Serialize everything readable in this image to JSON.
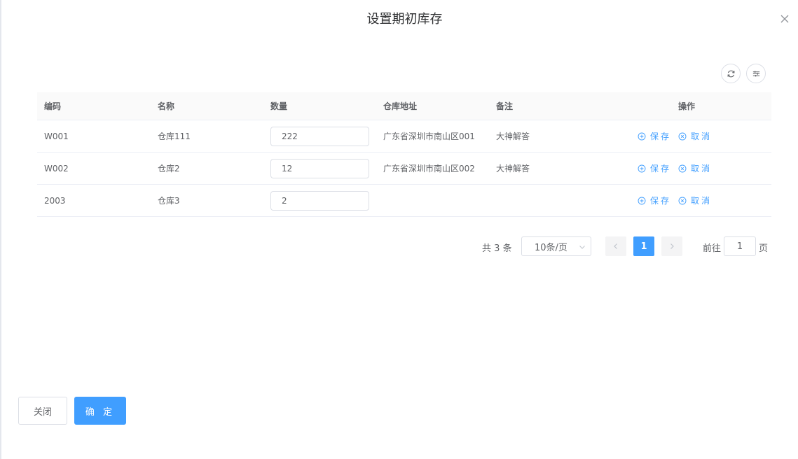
{
  "dialog": {
    "title": "设置期初库存"
  },
  "toolbar": {
    "refresh_icon": "refresh-icon",
    "settings_icon": "column-settings-icon"
  },
  "table": {
    "columns": [
      "编码",
      "名称",
      "数量",
      "仓库地址",
      "备注",
      "操作"
    ],
    "rows": [
      {
        "code": "W001",
        "name": "仓库111",
        "qty": "222",
        "address": "广东省深圳市南山区001",
        "remark": "大神解答"
      },
      {
        "code": "W002",
        "name": "仓库2",
        "qty": "12",
        "address": "广东省深圳市南山区002",
        "remark": "大神解答"
      },
      {
        "code": "2003",
        "name": "仓库3",
        "qty": "2",
        "address": "",
        "remark": ""
      }
    ],
    "actions": {
      "save": "保存",
      "cancel": "取消"
    }
  },
  "pagination": {
    "total_text": "共 3 条",
    "page_size": "10条/页",
    "current_page": "1",
    "goto_label": "前往",
    "goto_value": "1",
    "page_suffix": "页"
  },
  "footer": {
    "close_label": "关闭",
    "confirm_label": "确 定"
  },
  "colors": {
    "primary": "#409eff",
    "border": "#dcdfe6",
    "text": "#606266",
    "header_bg": "#fafafa"
  }
}
